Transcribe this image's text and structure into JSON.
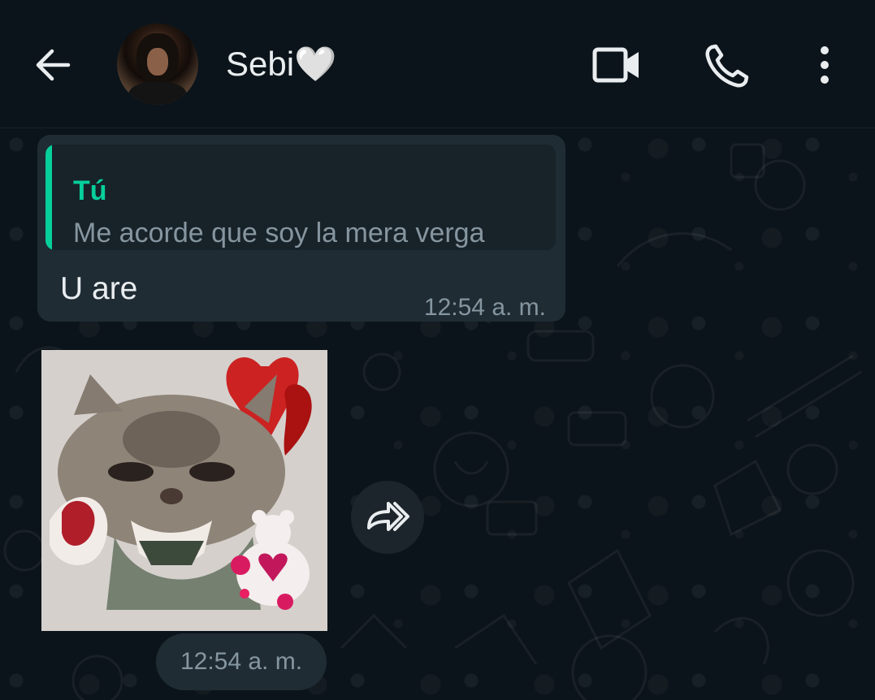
{
  "header": {
    "contact_name": "Sebi🤍",
    "icons": {
      "back": "arrow-left-icon",
      "video": "video-call-icon",
      "phone": "voice-call-icon",
      "menu": "more-vertical-icon"
    }
  },
  "messages": [
    {
      "type": "text-reply",
      "quoted_author": "Tú",
      "quoted_text": "Me acorde que soy la mera verga",
      "text": "U are",
      "time": "12:54 a. m."
    },
    {
      "type": "sticker",
      "sticker_description_icon": "crying-kitten-sticker",
      "time": "12:54 a. m.",
      "forward_icon": "forward-icon"
    }
  ],
  "colors": {
    "background": "#0b141a",
    "bubble_incoming": "#1f2c34",
    "quote_accent": "#06cf9c",
    "secondary_text": "#8696a0"
  }
}
